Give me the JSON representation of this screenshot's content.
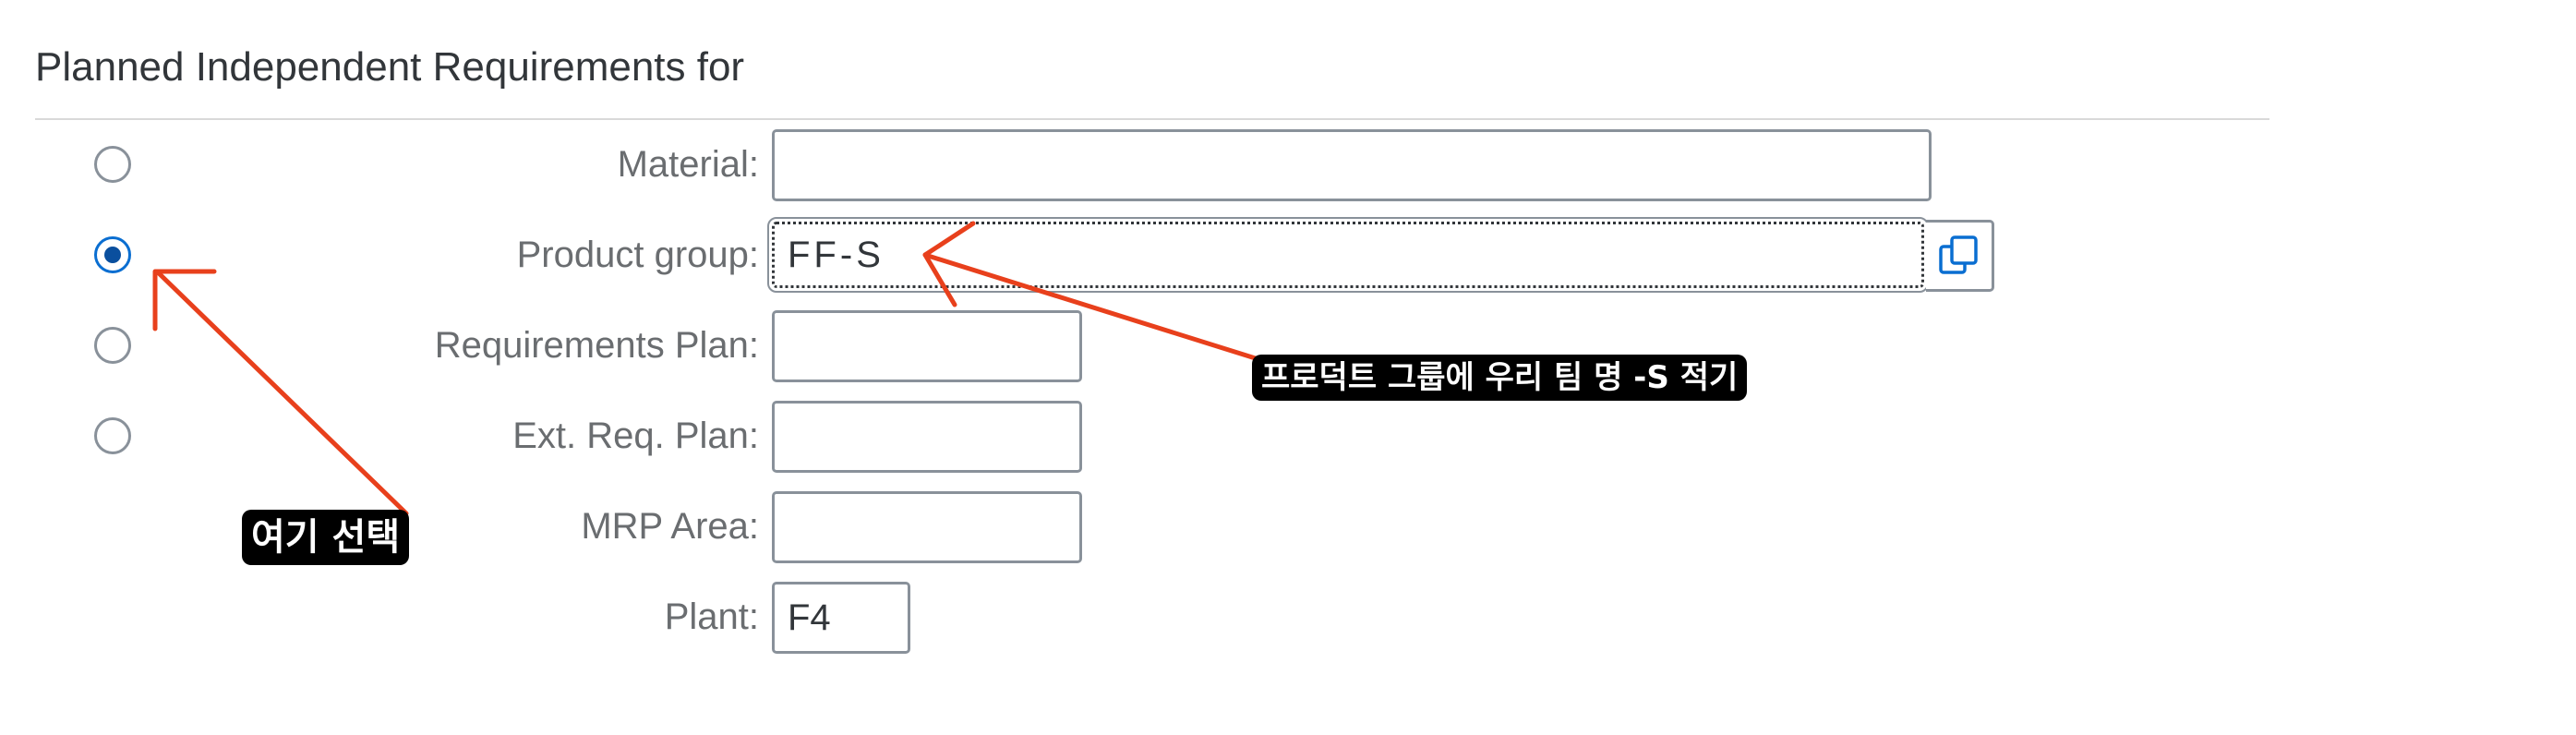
{
  "section": {
    "title": "Planned Independent Requirements for"
  },
  "fields": {
    "material": {
      "label": "Material:",
      "value": ""
    },
    "product_group": {
      "label": "Product group:",
      "value": "FF-S"
    },
    "requirements_plan": {
      "label": "Requirements Plan:",
      "value": ""
    },
    "ext_req_plan": {
      "label": "Ext. Req. Plan:",
      "value": ""
    },
    "mrp_area": {
      "label": "MRP Area:",
      "value": ""
    },
    "plant": {
      "label": "Plant:",
      "value": "F4"
    }
  },
  "radios": {
    "selected": "product_group"
  },
  "annotations": {
    "select_here": "여기 선택",
    "product_group_hint": "프로덕트 그룹에 우리 팀 명 -S 적기"
  },
  "icons": {
    "value_help": "value-help-icon",
    "arrow": "arrow-icon"
  },
  "colors": {
    "accent": "#0a6ed1",
    "annotation_arrow": "#e8401c",
    "annotation_bg": "#000000"
  }
}
